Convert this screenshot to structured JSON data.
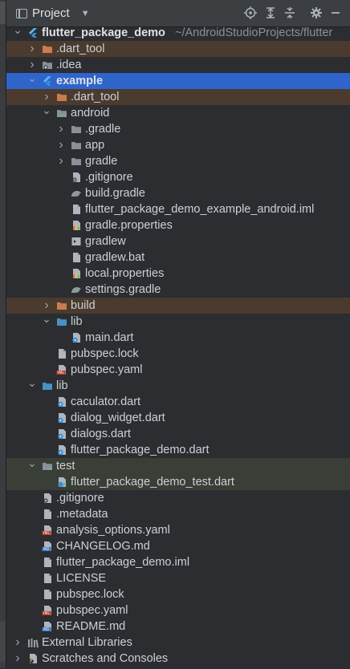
{
  "panel": {
    "title": "Project"
  },
  "tree": [
    {
      "label": "flutter_package_demo",
      "path": "~/AndroidStudioProjects/flutter",
      "depth": 0,
      "expanded": true,
      "icon": "flutter-icon",
      "bold": true,
      "style": "normal"
    },
    {
      "label": ".dart_tool",
      "depth": 1,
      "expanded": false,
      "icon": "folder-excluded-icon",
      "style": "excl"
    },
    {
      "label": ".idea",
      "depth": 1,
      "expanded": false,
      "icon": "folder-settings-icon",
      "style": "normal"
    },
    {
      "label": "example",
      "depth": 1,
      "expanded": true,
      "icon": "flutter-icon",
      "bold": true,
      "style": "sel"
    },
    {
      "label": ".dart_tool",
      "depth": 2,
      "expanded": false,
      "icon": "folder-excluded-icon",
      "style": "excl"
    },
    {
      "label": "android",
      "depth": 2,
      "expanded": true,
      "icon": "folder-android-icon",
      "style": "normal"
    },
    {
      "label": ".gradle",
      "depth": 3,
      "expanded": false,
      "icon": "folder-icon",
      "style": "normal"
    },
    {
      "label": "app",
      "depth": 3,
      "expanded": false,
      "icon": "folder-icon",
      "style": "normal"
    },
    {
      "label": "gradle",
      "depth": 3,
      "expanded": false,
      "icon": "folder-icon",
      "style": "normal"
    },
    {
      "label": ".gitignore",
      "depth": 3,
      "icon": "gitignore-icon",
      "style": "normal"
    },
    {
      "label": "build.gradle",
      "depth": 3,
      "icon": "gradle-icon",
      "style": "normal"
    },
    {
      "label": "flutter_package_demo_example_android.iml",
      "depth": 3,
      "icon": "file-icon",
      "style": "normal"
    },
    {
      "label": "gradle.properties",
      "depth": 3,
      "icon": "properties-icon",
      "style": "normal"
    },
    {
      "label": "gradlew",
      "depth": 3,
      "icon": "terminal-icon",
      "style": "normal"
    },
    {
      "label": "gradlew.bat",
      "depth": 3,
      "icon": "file-icon",
      "style": "normal"
    },
    {
      "label": "local.properties",
      "depth": 3,
      "icon": "properties-icon",
      "style": "normal"
    },
    {
      "label": "settings.gradle",
      "depth": 3,
      "icon": "gradle-icon",
      "style": "normal"
    },
    {
      "label": "build",
      "depth": 2,
      "expanded": false,
      "icon": "folder-excluded-icon",
      "style": "excl"
    },
    {
      "label": "lib",
      "depth": 2,
      "expanded": true,
      "icon": "folder-source-icon",
      "style": "normal"
    },
    {
      "label": "main.dart",
      "depth": 3,
      "icon": "dart-icon",
      "style": "normal"
    },
    {
      "label": "pubspec.lock",
      "depth": 2,
      "icon": "file-icon",
      "style": "normal"
    },
    {
      "label": "pubspec.yaml",
      "depth": 2,
      "icon": "yaml-icon",
      "style": "normal"
    },
    {
      "label": "lib",
      "depth": 1,
      "expanded": true,
      "icon": "folder-source-icon",
      "style": "normal"
    },
    {
      "label": "caculator.dart",
      "depth": 2,
      "icon": "dart-icon",
      "style": "normal"
    },
    {
      "label": "dialog_widget.dart",
      "depth": 2,
      "icon": "dart-icon",
      "style": "normal"
    },
    {
      "label": "dialogs.dart",
      "depth": 2,
      "icon": "dart-icon",
      "style": "normal"
    },
    {
      "label": "flutter_package_demo.dart",
      "depth": 2,
      "icon": "dart-icon",
      "style": "normal"
    },
    {
      "label": "test",
      "depth": 1,
      "expanded": true,
      "icon": "folder-test-icon",
      "style": "test"
    },
    {
      "label": "flutter_package_demo_test.dart",
      "depth": 2,
      "icon": "dart-test-icon",
      "style": "test"
    },
    {
      "label": ".gitignore",
      "depth": 1,
      "icon": "gitignore-icon",
      "style": "normal"
    },
    {
      "label": ".metadata",
      "depth": 1,
      "icon": "file-icon",
      "style": "normal"
    },
    {
      "label": "analysis_options.yaml",
      "depth": 1,
      "icon": "yaml-icon",
      "style": "normal"
    },
    {
      "label": "CHANGELOG.md",
      "depth": 1,
      "icon": "markdown-icon",
      "style": "normal"
    },
    {
      "label": "flutter_package_demo.iml",
      "depth": 1,
      "icon": "file-icon",
      "style": "normal"
    },
    {
      "label": "LICENSE",
      "depth": 1,
      "icon": "file-icon",
      "style": "normal"
    },
    {
      "label": "pubspec.lock",
      "depth": 1,
      "icon": "file-icon",
      "style": "normal"
    },
    {
      "label": "pubspec.yaml",
      "depth": 1,
      "icon": "yaml-icon",
      "style": "normal"
    },
    {
      "label": "README.md",
      "depth": 1,
      "icon": "markdown-icon",
      "style": "normal"
    },
    {
      "label": "External Libraries",
      "depth": 0,
      "expanded": false,
      "icon": "libraries-icon",
      "style": "normal"
    },
    {
      "label": "Scratches and Consoles",
      "depth": 0,
      "expanded": false,
      "icon": "scratches-icon",
      "style": "normal"
    }
  ]
}
